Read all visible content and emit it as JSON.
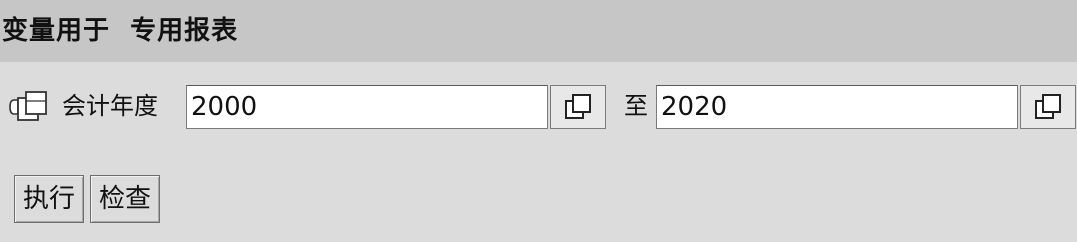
{
  "header": {
    "title": "变量用于  专用报表"
  },
  "selection": {
    "field_label": "会计年度",
    "low_value": "2000",
    "to_label": "至",
    "high_value": "2020",
    "field_icon": "selection-option-icon",
    "multi_select_icon": "copy-icon"
  },
  "actions": {
    "execute_label": "执行",
    "check_label": "检查"
  },
  "colors": {
    "background": "#dcdcdc",
    "title_bar": "#c6c6c6",
    "input_background": "#ffffff"
  }
}
